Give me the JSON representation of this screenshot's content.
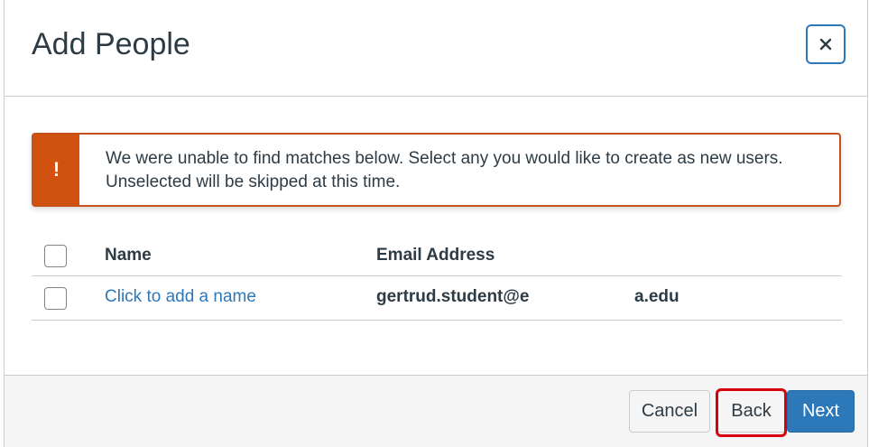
{
  "dialog": {
    "title": "Add People",
    "close_icon": "close-icon"
  },
  "alert": {
    "icon": "!",
    "message": "We were unable to find matches below. Select any you would like to create as new users. Unselected will be skipped at this time."
  },
  "table": {
    "headers": {
      "name": "Name",
      "email": "Email Address"
    },
    "rows": [
      {
        "name": "Click to add a name",
        "email_visible_start": "gertrud.student@e",
        "email_visible_end": "a.edu"
      }
    ]
  },
  "footer": {
    "cancel_label": "Cancel",
    "back_label": "Back",
    "next_label": "Next"
  },
  "colors": {
    "accent": "#2d78b8",
    "alert": "#d05110",
    "highlight": "#d8000c"
  }
}
